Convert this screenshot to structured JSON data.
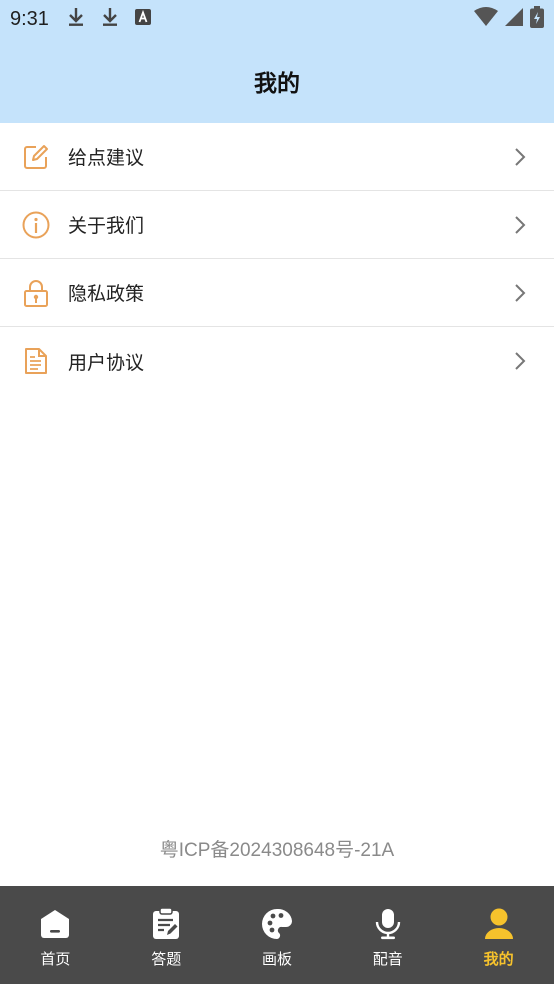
{
  "status": {
    "time": "9:31"
  },
  "header": {
    "title": "我的"
  },
  "menu": [
    {
      "label": "给点建议",
      "icon": "edit-icon"
    },
    {
      "label": "关于我们",
      "icon": "info-icon"
    },
    {
      "label": "隐私政策",
      "icon": "lock-icon"
    },
    {
      "label": "用户协议",
      "icon": "document-icon"
    }
  ],
  "footer": {
    "icp": "粤ICP备2024308648号-21A"
  },
  "tabs": [
    {
      "label": "首页",
      "icon": "home-icon"
    },
    {
      "label": "答题",
      "icon": "clipboard-icon"
    },
    {
      "label": "画板",
      "icon": "palette-icon"
    },
    {
      "label": "配音",
      "icon": "microphone-icon"
    },
    {
      "label": "我的",
      "icon": "user-icon",
      "active": true
    }
  ],
  "colors": {
    "header_bg": "#c5e3fb",
    "accent_icon": "#e9a259",
    "tab_active": "#f6c22c",
    "tabbar_bg": "#4a4a4a"
  }
}
